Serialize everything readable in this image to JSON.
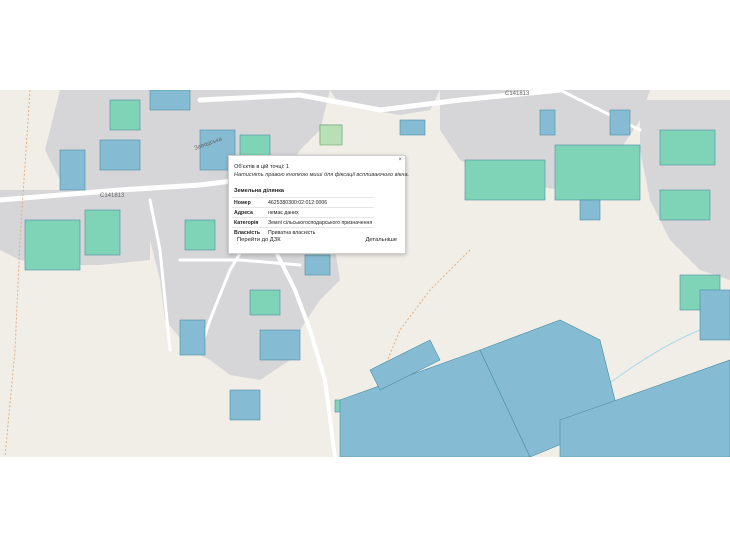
{
  "map": {
    "road_labels": [
      "C141813",
      "C141813",
      "Заводська"
    ],
    "colors": {
      "background": "#f1eee8",
      "built_area": "#d6d6d8",
      "parcel_private": "#7fd4b8",
      "parcel_state": "#86bcd3",
      "parcel_border": "#4b8ea6",
      "road": "#ffffff",
      "path": "#e0b080"
    }
  },
  "popup": {
    "close": "×",
    "objects_count": "Об'єктів в цій точці: 1",
    "hint": "Натисніть правою кнопкою миші для фіксації вспливаючого вікна.",
    "title": "Земельна ділянка",
    "rows": [
      {
        "key": "Номер",
        "value": "4625380300:02:012:0006"
      },
      {
        "key": "Адреса",
        "value": "немає даних"
      },
      {
        "key": "Категорія",
        "value": "Землі сільськогосподарського призначення"
      },
      {
        "key": "Власність",
        "value": "Приватна власність"
      }
    ],
    "btn_left": "Перейти до ДЗК",
    "btn_right": "Детальніше"
  },
  "tools": {
    "edit_icon": "✎"
  }
}
